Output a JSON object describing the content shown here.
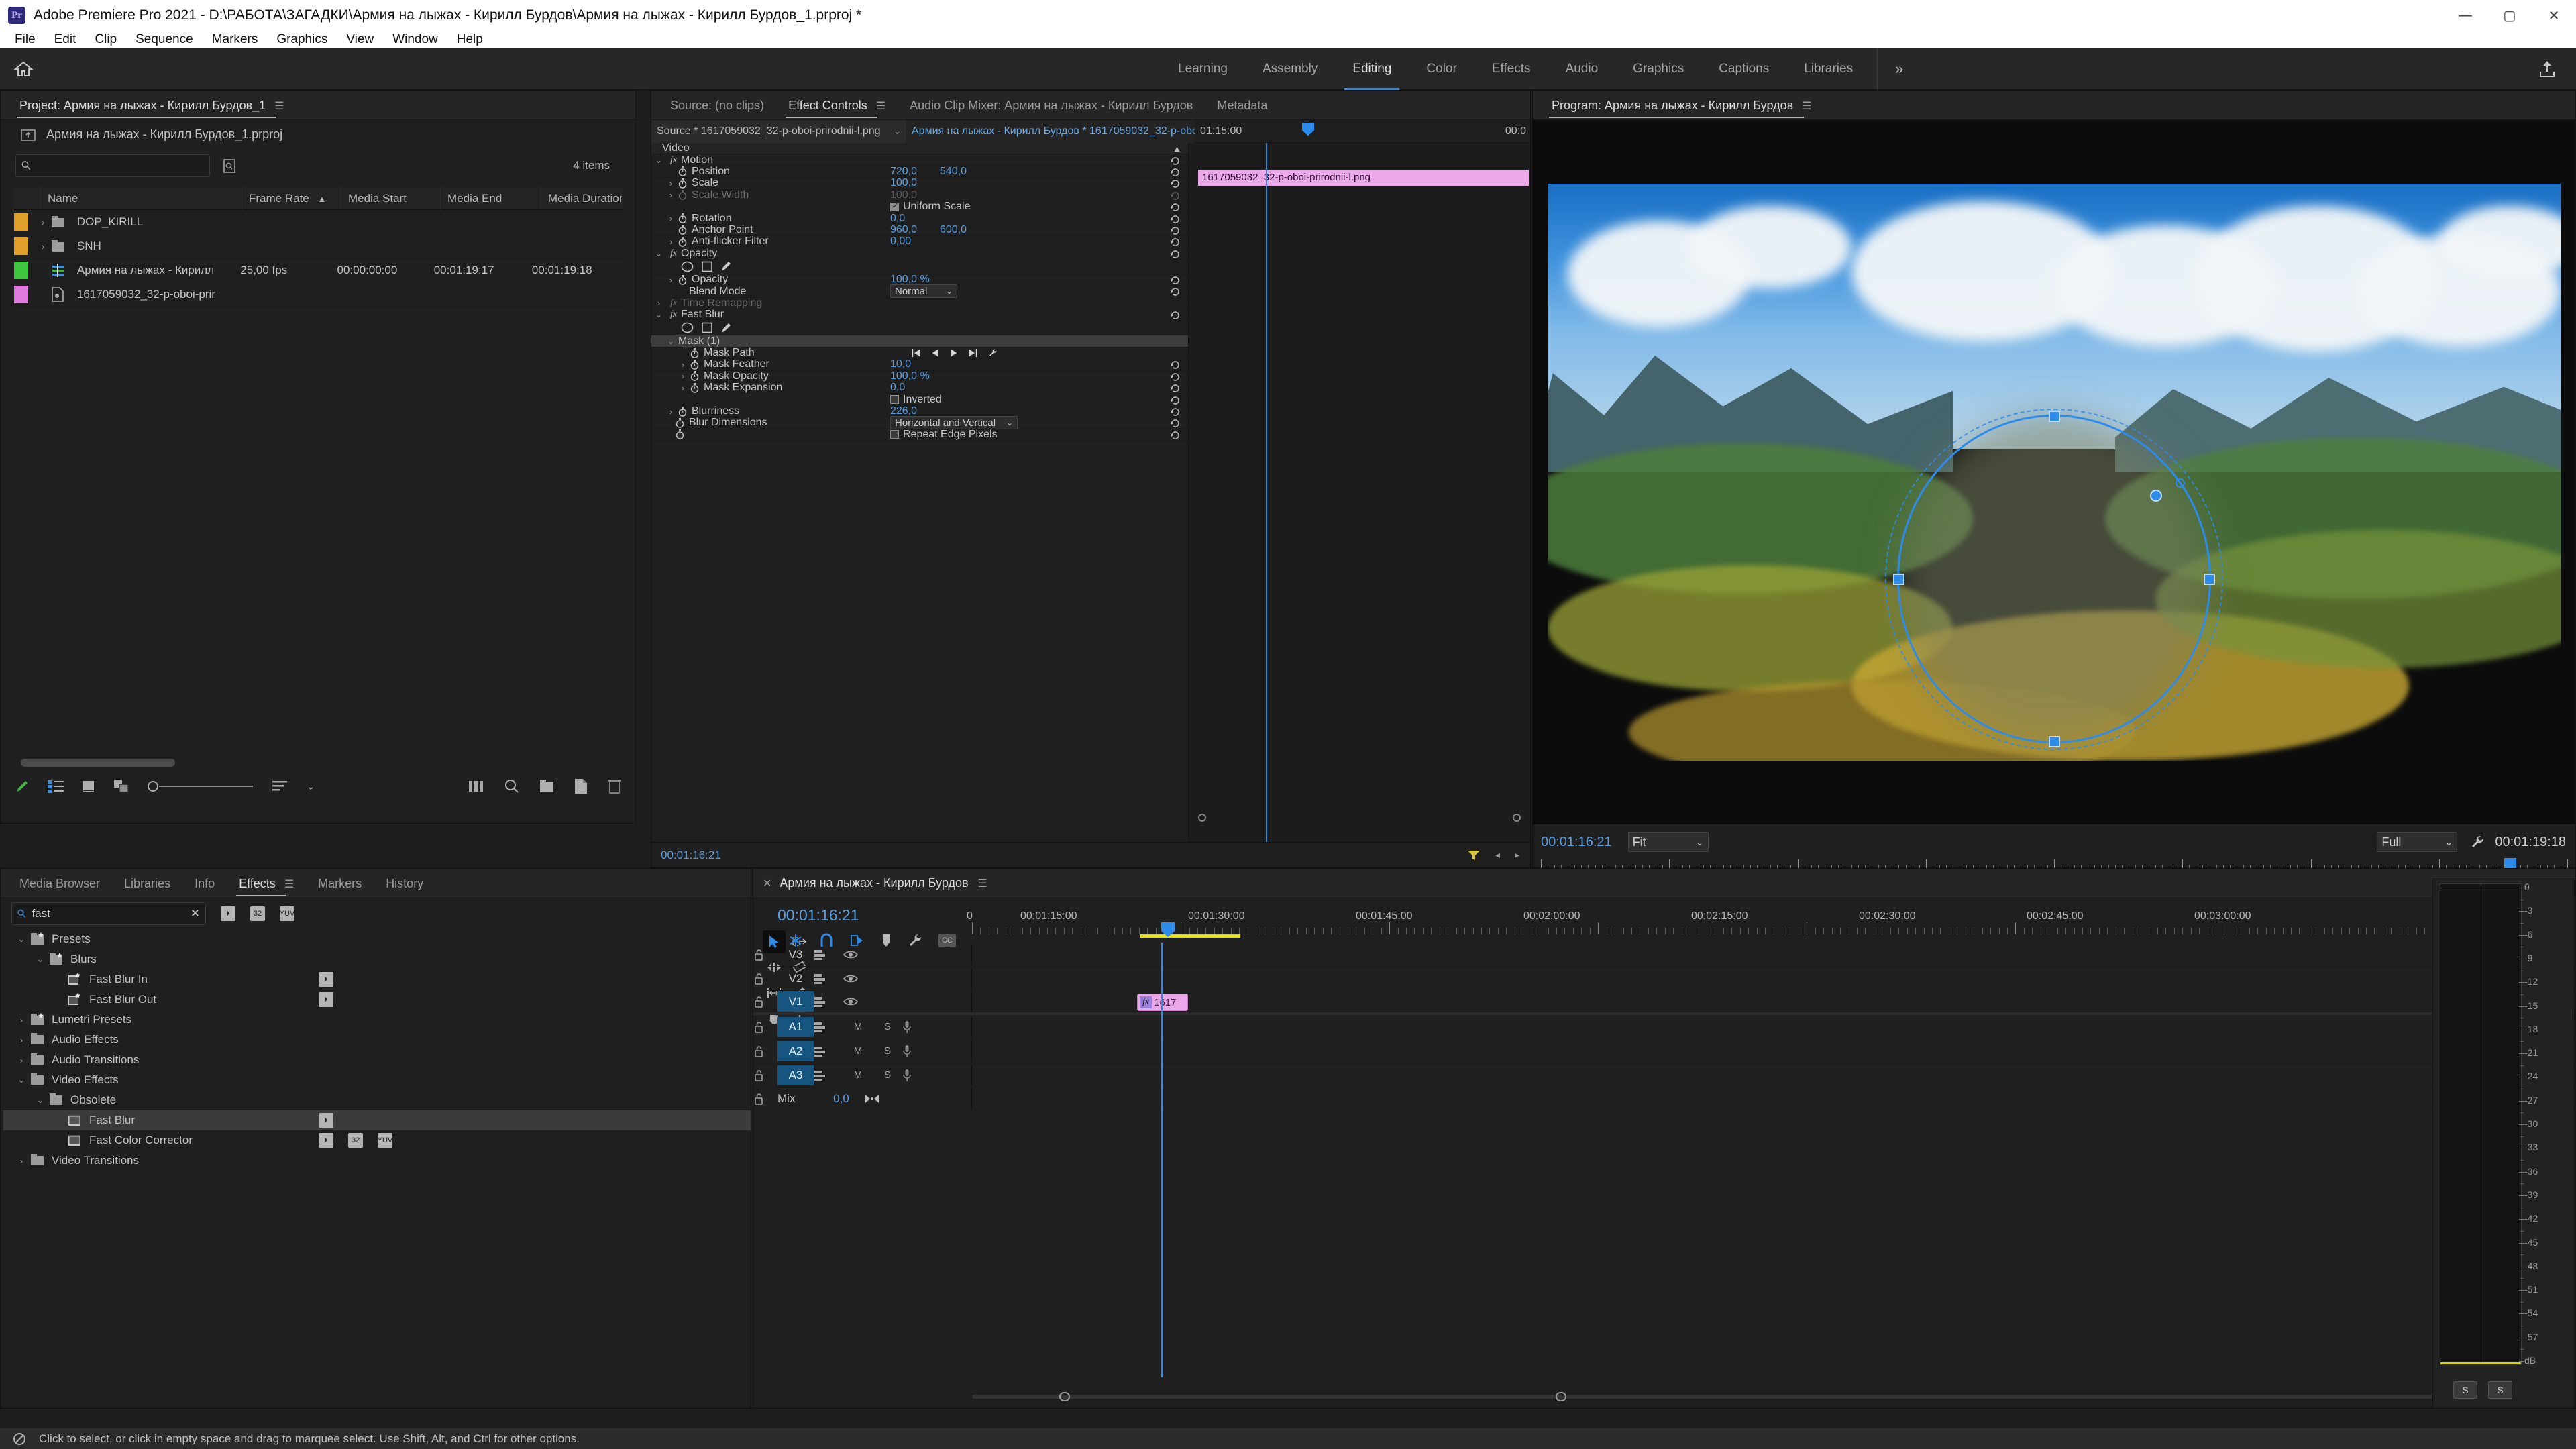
{
  "window": {
    "app_title": "Adobe Premiere Pro 2021 - D:\\РАБОТА\\ЗАГАДКИ\\Армия на лыжах - Кирилл Бурдов\\Армия на лыжах - Кирилл Бурдов_1.prproj *",
    "logo_text": "Pr",
    "minimize": "—",
    "maximize": "▢",
    "close": "✕"
  },
  "menubar": {
    "items": [
      "File",
      "Edit",
      "Clip",
      "Sequence",
      "Markers",
      "Graphics",
      "View",
      "Window",
      "Help"
    ]
  },
  "workspaces": {
    "home_icon": "home-icon",
    "tabs": [
      {
        "label": "Learning",
        "active": false
      },
      {
        "label": "Assembly",
        "active": false
      },
      {
        "label": "Editing",
        "active": true
      },
      {
        "label": "Color",
        "active": false
      },
      {
        "label": "Effects",
        "active": false
      },
      {
        "label": "Audio",
        "active": false
      },
      {
        "label": "Graphics",
        "active": false
      },
      {
        "label": "Captions",
        "active": false
      },
      {
        "label": "Libraries",
        "active": false
      }
    ],
    "more": "»",
    "export_icon": "export-icon"
  },
  "project_panel": {
    "tab_label": "Project: Армия на лыжах - Кирилл Бурдов_1",
    "menu_icon": "panel-menu-icon",
    "breadcrumb": "Армия на лыжах - Кирилл Бурдов_1.prproj",
    "breadcrumb_icon": "parent-bin-icon",
    "search_placeholder": "",
    "search_value": "",
    "search_icon": "search-icon",
    "find_icon": "find-icon",
    "item_count": "4 items",
    "columns": [
      "Name",
      "Frame Rate",
      "Media Start",
      "Media End",
      "Media Duration"
    ],
    "sort_column": "Frame Rate",
    "sort_arrow": "▲",
    "rows": [
      {
        "swatch": "#e0a02a",
        "twirl": "›",
        "icon": "bin-icon",
        "name": "DOP_KIRILL",
        "frame_rate": "",
        "media_start": "",
        "media_end": "",
        "media_duration": ""
      },
      {
        "swatch": "#e0a02a",
        "twirl": "›",
        "icon": "bin-icon",
        "name": "SNH",
        "frame_rate": "",
        "media_start": "",
        "media_end": "",
        "media_duration": ""
      },
      {
        "swatch": "#3ec43e",
        "twirl": "",
        "icon": "sequence-icon",
        "name": "Армия на лыжах - Кирилл",
        "frame_rate": "25,00 fps",
        "media_start": "00:00:00:00",
        "media_end": "00:01:19:17",
        "media_duration": "00:01:19:18"
      },
      {
        "swatch": "#e07ae0",
        "twirl": "",
        "icon": "still-icon",
        "name": "1617059032_32-p-oboi-prir",
        "frame_rate": "",
        "media_start": "",
        "media_end": "",
        "media_duration": ""
      }
    ],
    "toolbar_icons": [
      "pen-icon",
      "list-view-icon",
      "icon-view-icon",
      "freeform-view-icon",
      "zoom-slider",
      "sort-icon",
      "chevron-down-icon"
    ],
    "toolbar_right_icons": [
      "thumbnail-size-icon",
      "find-icon",
      "new-bin-icon",
      "new-item-icon",
      "delete-icon"
    ]
  },
  "effect_controls": {
    "tabs": [
      {
        "label": "Source: (no clips)",
        "active": false
      },
      {
        "label": "Effect Controls",
        "active": true
      },
      {
        "label": "Audio Clip Mixer: Армия на лыжах - Кирилл Бурдов",
        "active": false
      },
      {
        "label": "Metadata",
        "active": false
      }
    ],
    "source_clip": "Source * 1617059032_32-p-oboi-prirodnii-l.png",
    "sequence_clip": "Армия на лыжах - Кирилл Бурдов * 1617059032_32-p-oboi-prirodnii-...",
    "video_section": "Video",
    "timeline_clip_label": "1617059032_32-p-oboi-prirodnii-l.png",
    "ruler_labels": [
      "01:15:00",
      "00:0"
    ],
    "playhead_timecode": "00:01:16:21",
    "params": [
      {
        "type": "section",
        "name": "Video",
        "collapse": "▲"
      },
      {
        "type": "effect",
        "twirl": "⌄",
        "fx": "fx",
        "name": "Motion",
        "reset": true
      },
      {
        "type": "param",
        "twirl": "",
        "stopwatch": true,
        "name": "Position",
        "values": [
          "720,0",
          "540,0"
        ],
        "reset": true
      },
      {
        "type": "param",
        "twirl": "›",
        "stopwatch": true,
        "name": "Scale",
        "values": [
          "100,0"
        ],
        "reset": true
      },
      {
        "type": "param",
        "twirl": "›",
        "stopwatch": true,
        "name": "Scale Width",
        "values": [
          "100,0"
        ],
        "disabled": true,
        "reset": true
      },
      {
        "type": "checkbox",
        "name": "Uniform Scale",
        "checked": true,
        "reset": true
      },
      {
        "type": "param",
        "twirl": "›",
        "stopwatch": true,
        "name": "Rotation",
        "values": [
          "0,0"
        ],
        "reset": true
      },
      {
        "type": "param",
        "twirl": "",
        "stopwatch": true,
        "name": "Anchor Point",
        "values": [
          "960,0",
          "600,0"
        ],
        "reset": true
      },
      {
        "type": "param",
        "twirl": "›",
        "stopwatch": true,
        "name": "Anti-flicker Filter",
        "values": [
          "0,00"
        ],
        "reset": true
      },
      {
        "type": "effect",
        "twirl": "⌄",
        "fx": "fx",
        "name": "Opacity",
        "reset": true
      },
      {
        "type": "shapes",
        "icons": [
          "ellipse-mask-icon",
          "rect-mask-icon",
          "pen-mask-icon"
        ]
      },
      {
        "type": "param",
        "twirl": "›",
        "stopwatch": true,
        "name": "Opacity",
        "values": [
          "100,0 %"
        ],
        "reset": true
      },
      {
        "type": "dropdown",
        "name": "Blend Mode",
        "value": "Normal",
        "reset": true
      },
      {
        "type": "effect",
        "twirl": "›",
        "fx": "fx",
        "name": "Time Remapping",
        "disabled": true
      },
      {
        "type": "effect",
        "twirl": "⌄",
        "fx": "fx",
        "name": "Fast Blur",
        "reset": true
      },
      {
        "type": "shapes",
        "icons": [
          "ellipse-mask-icon",
          "rect-mask-icon",
          "pen-mask-icon"
        ]
      },
      {
        "type": "maskheader",
        "twirl": "⌄",
        "name": "Mask (1)"
      },
      {
        "type": "maskpath",
        "stopwatch": true,
        "name": "Mask Path",
        "icons": [
          "prev-keyframe-far-icon",
          "prev-keyframe-icon",
          "play-icon",
          "next-keyframe-icon",
          "tracking-settings-icon"
        ]
      },
      {
        "type": "param",
        "twirl": "›",
        "stopwatch": true,
        "name": "Mask Feather",
        "values": [
          "10,0"
        ],
        "indent": true,
        "reset": true
      },
      {
        "type": "param",
        "twirl": "›",
        "stopwatch": true,
        "name": "Mask Opacity",
        "values": [
          "100,0 %"
        ],
        "indent": true,
        "reset": true
      },
      {
        "type": "param",
        "twirl": "›",
        "stopwatch": true,
        "name": "Mask Expansion",
        "values": [
          "0,0"
        ],
        "indent": true,
        "reset": true
      },
      {
        "type": "checkbox",
        "name": "Inverted",
        "checked": false,
        "reset": true
      },
      {
        "type": "param",
        "twirl": "›",
        "stopwatch": true,
        "name": "Blurriness",
        "values": [
          "226,0"
        ],
        "reset": true
      },
      {
        "type": "dropdown2",
        "stopwatch": true,
        "name": "Blur Dimensions",
        "value": "Horizontal and Vertical",
        "reset": true
      },
      {
        "type": "checkbox2",
        "stopwatch": true,
        "name": "Repeat Edge Pixels",
        "checked": false,
        "reset": true
      }
    ],
    "footer_timecode": "00:01:16:21"
  },
  "program_monitor": {
    "tab_label": "Program: Армия на лыжах - Кирилл Бурдов",
    "menu_icon": "panel-menu-icon",
    "playhead_timecode": "00:01:16:21",
    "zoom_level": "Fit",
    "playback_resolution": "Full",
    "settings_icon": "wrench-icon",
    "duration_timecode": "00:01:19:18",
    "transport_icons": [
      "add-marker-icon",
      "mark-in-icon",
      "mark-out-icon",
      "go-to-in-icon",
      "step-back-icon",
      "play-icon",
      "step-forward-icon",
      "go-to-out-icon",
      "lift-icon",
      "extract-icon",
      "export-frame-icon",
      "comparison-view-icon"
    ],
    "plus_icon": "button-editor-icon"
  },
  "effects_panel": {
    "tabs": [
      {
        "label": "Media Browser",
        "active": false
      },
      {
        "label": "Libraries",
        "active": false
      },
      {
        "label": "Info",
        "active": false
      },
      {
        "label": "Effects",
        "active": true
      },
      {
        "label": "Markers",
        "active": false
      },
      {
        "label": "History",
        "active": false
      }
    ],
    "search_value": "fast",
    "search_icon": "search-icon",
    "clear_icon": "clear-icon",
    "filter_badges": [
      "accelerated-icon",
      "32",
      "YUV"
    ],
    "tree": [
      {
        "depth": 0,
        "twirl": "⌄",
        "icon": "preset-bin-icon",
        "label": "Presets",
        "badges": []
      },
      {
        "depth": 1,
        "twirl": "⌄",
        "icon": "preset-bin-icon",
        "label": "Blurs",
        "badges": []
      },
      {
        "depth": 2,
        "twirl": "",
        "icon": "preset-icon",
        "label": "Fast Blur In",
        "badges": [
          "accelerated-icon"
        ]
      },
      {
        "depth": 2,
        "twirl": "",
        "icon": "preset-icon",
        "label": "Fast Blur Out",
        "badges": [
          "accelerated-icon"
        ]
      },
      {
        "depth": 0,
        "twirl": "›",
        "icon": "preset-bin-icon",
        "label": "Lumetri Presets",
        "badges": []
      },
      {
        "depth": 0,
        "twirl": "›",
        "icon": "bin-icon",
        "label": "Audio Effects",
        "badges": []
      },
      {
        "depth": 0,
        "twirl": "›",
        "icon": "bin-icon",
        "label": "Audio Transitions",
        "badges": []
      },
      {
        "depth": 0,
        "twirl": "⌄",
        "icon": "bin-icon",
        "label": "Video Effects",
        "badges": []
      },
      {
        "depth": 1,
        "twirl": "⌄",
        "icon": "bin-icon",
        "label": "Obsolete",
        "badges": []
      },
      {
        "depth": 2,
        "twirl": "",
        "icon": "effect-icon",
        "label": "Fast Blur",
        "badges": [
          "accelerated-icon"
        ],
        "selected": true
      },
      {
        "depth": 2,
        "twirl": "",
        "icon": "effect-icon",
        "label": "Fast Color Corrector",
        "badges": [
          "accelerated-icon",
          "32",
          "YUV"
        ]
      },
      {
        "depth": 0,
        "twirl": "›",
        "icon": "bin-icon",
        "label": "Video Transitions",
        "badges": []
      }
    ]
  },
  "timeline": {
    "close_icon": "close-icon",
    "tab_label": "Армия на лыжах - Кирилл Бурдов",
    "menu_icon": "panel-menu-icon",
    "playhead_timecode": "00:01:16:21",
    "tools": [
      {
        "name": "selection-tool",
        "active": true
      },
      {
        "name": "track-select-forward-tool",
        "active": false
      },
      {
        "name": "ripple-edit-tool",
        "active": false
      },
      {
        "name": "rolling-edit-tool",
        "active": false
      },
      {
        "name": "slip-tool",
        "active": false
      },
      {
        "name": "pen-tool",
        "active": false
      },
      {
        "name": "hand-tool",
        "active": false
      },
      {
        "name": "type-tool",
        "active": false
      }
    ],
    "toggle_icons": [
      "nest-sequence-icon",
      "snap-icon",
      "linked-selection-icon",
      "add-marker-icon",
      "timeline-settings-icon",
      "captions-icon"
    ],
    "ruler_labels": [
      "00:01:15:00",
      "00:01:30:00",
      "00:01:45:00",
      "00:02:00:00",
      "00:02:15:00",
      "00:02:30:00",
      "00:02:45:00",
      "00:03:00:00"
    ],
    "tracks": [
      {
        "name": "V3",
        "type": "video",
        "targeted": false,
        "lock": "🔓",
        "sync": "sync-lock-icon",
        "eye": "eye-icon"
      },
      {
        "name": "V2",
        "type": "video",
        "targeted": false,
        "lock": "🔓",
        "sync": "sync-lock-icon",
        "eye": "eye-icon"
      },
      {
        "name": "V1",
        "type": "video",
        "targeted": true,
        "lock": "🔓",
        "sync": "sync-lock-icon",
        "eye": "eye-icon"
      },
      {
        "name": "A1",
        "type": "audio",
        "targeted": true,
        "lock": "🔓",
        "sync": "sync-lock-icon",
        "mute": "M",
        "solo": "S",
        "mic": "mic-icon"
      },
      {
        "name": "A2",
        "type": "audio",
        "targeted": true,
        "lock": "🔓",
        "sync": "sync-lock-icon",
        "mute": "M",
        "solo": "S",
        "mic": "mic-icon"
      },
      {
        "name": "A3",
        "type": "audio",
        "targeted": true,
        "lock": "🔓",
        "sync": "sync-lock-icon",
        "mute": "M",
        "solo": "S",
        "mic": "mic-icon"
      }
    ],
    "master": {
      "name": "Mix",
      "value": "0,0",
      "pan_icon": "pan-icon",
      "lock": "🔓"
    },
    "clip": {
      "track": "V1",
      "fx_badge": "fx",
      "label": "1617"
    }
  },
  "audio_meters": {
    "ticks": [
      "0",
      "-3",
      "-6",
      "-9",
      "-12",
      "-15",
      "-18",
      "-21",
      "-24",
      "-27",
      "-30",
      "-33",
      "-36",
      "-39",
      "-42",
      "-45",
      "-48",
      "-51",
      "-54",
      "-57",
      "dB"
    ],
    "solo_buttons": [
      "S",
      "S"
    ]
  },
  "statusbar": {
    "icon": "no-drop-icon",
    "text": "Click to select, or click in empty space and drag to marquee select. Use Shift, Alt, and Ctrl for other options."
  },
  "colors": {
    "accent_blue": "#2d8ceb",
    "value_blue": "#5b9ee0",
    "clip_pink": "#eaa8ea",
    "bin_orange": "#e0a02a",
    "sequence_green": "#3ec43e",
    "target_blue": "#15557f",
    "panel_bg": "#1f1f1f",
    "tab_bg": "#252525"
  }
}
